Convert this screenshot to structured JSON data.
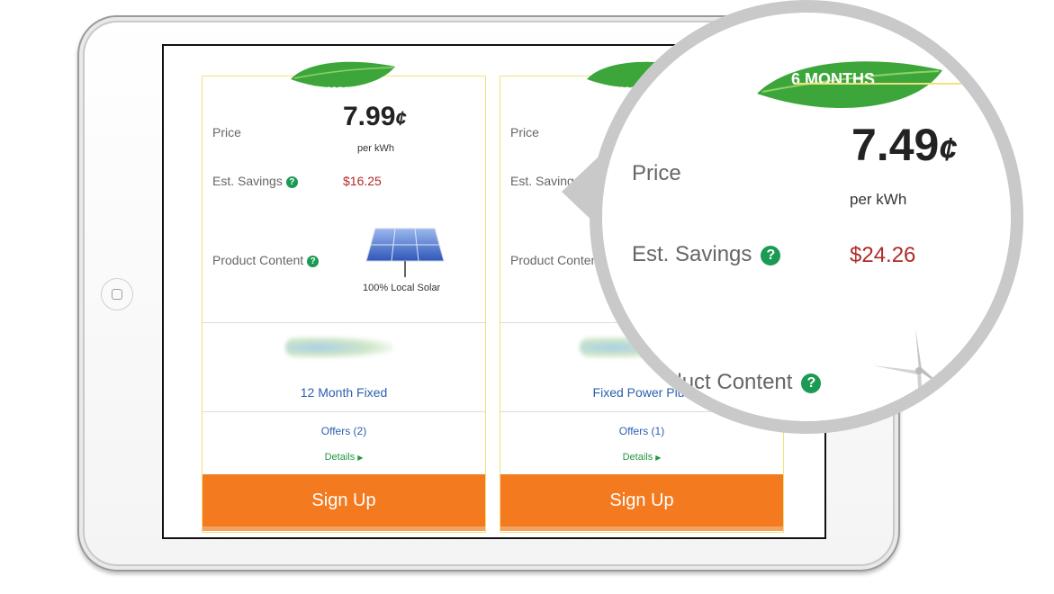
{
  "plans": [
    {
      "term": "12 MONTHS",
      "price_label": "Price",
      "price": "7.99",
      "price_unit": "¢",
      "per_unit": "per kWh",
      "savings_label": "Est. Savings",
      "savings": "$16.25",
      "content_label": "Product Content",
      "content_caption": "100% Local Solar",
      "plan_name": "12 Month Fixed",
      "offers": "Offers (2)",
      "details": "Details",
      "signup": "Sign Up"
    },
    {
      "term": "6 MONTHS",
      "price_label": "Price",
      "price": "7.49",
      "price_unit": "¢",
      "per_unit": "per kWh",
      "savings_label": "Est. Savings",
      "savings": "$24.26",
      "content_label": "Product Content",
      "plan_name": "Fixed Power Plus",
      "offers": "Offers (1)",
      "details": "Details",
      "signup": "Sign Up"
    }
  ],
  "colors": {
    "accent_orange": "#f47a20",
    "savings_red": "#b02a2a",
    "link_blue": "#2b5fae",
    "help_green": "#1a9a52",
    "card_border": "#f1e17a"
  },
  "icons": [
    "help-icon",
    "solar-panel-icon",
    "wind-turbine-icon",
    "leaf-badge-icon",
    "play-arrow-icon"
  ]
}
